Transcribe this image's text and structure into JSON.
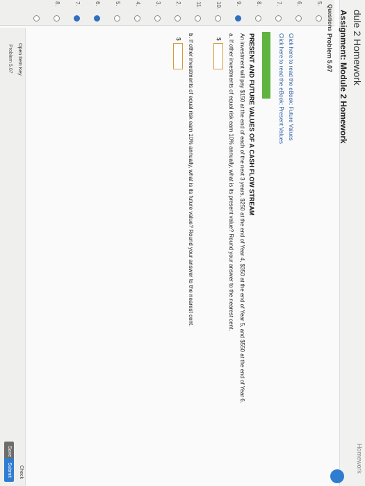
{
  "header": {
    "module_title": "dule 2 Homework",
    "assignment_title": "Assignment: Module 2 Homework",
    "edge_label": "Homework"
  },
  "sidebar": {
    "header": "Questions",
    "rows": [
      {
        "num": "5.",
        "state": "empty"
      },
      {
        "num": "6.",
        "state": "empty"
      },
      {
        "num": "7.",
        "state": "empty"
      },
      {
        "num": "8.",
        "state": "empty"
      },
      {
        "num": "9.",
        "state": "filled"
      },
      {
        "num": "10.",
        "state": "empty"
      },
      {
        "num": "11.",
        "state": "empty"
      },
      {
        "num": "2.",
        "state": "empty"
      },
      {
        "num": "3.",
        "state": "empty"
      },
      {
        "num": "4.",
        "state": "empty"
      },
      {
        "num": "5.",
        "state": "empty"
      },
      {
        "num": "6.",
        "state": "filled"
      },
      {
        "num": "7.",
        "state": "filled"
      },
      {
        "num": "8.",
        "state": "empty"
      },
      {
        "num": "",
        "state": "empty"
      }
    ]
  },
  "main": {
    "problem_label": "Problem 5.07",
    "link_future": "Click here to read the eBook: Future Values",
    "link_present": "Click here to read the eBook: Present Values",
    "heading": "PRESENT AND FUTURE VALUES OF A CASH FLOW STREAM",
    "paragraph": "An investment will pay $150 at the end of each of the next 3 years, $250 at the end of Year 4, $350 at the end of Year 5, and $550 at the end of Year 6.",
    "question_a": "a.  If other investments of equal risk earn 10% annually, what is its present value? Round your answer to the nearest cent.",
    "question_b": "b.  If other investments of equal risk earn 10% annually, what is its future value? Round your answer to the nearest cent.",
    "currency": "$",
    "answer_a": "",
    "answer_b": ""
  },
  "footer": {
    "open_key": "Open Item Key",
    "problem": "Problem 5.07",
    "check": "Check",
    "save": "Save",
    "submit": "Submit"
  }
}
